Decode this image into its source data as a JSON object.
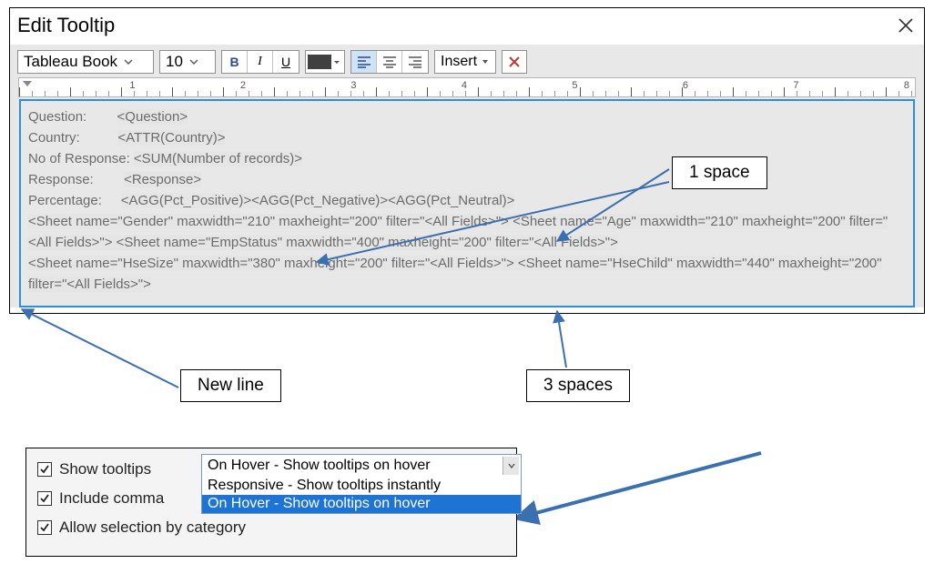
{
  "dialog": {
    "title": "Edit Tooltip",
    "font": "Tableau Book",
    "fontSize": "10",
    "insertLabel": "Insert",
    "ruler": [
      "1",
      "2",
      "3",
      "4",
      "5",
      "6",
      "7",
      "8"
    ]
  },
  "tooltip": {
    "r1a": "Question:        ",
    "r1b": "<Question>",
    "r2a": "Country:          ",
    "r2b": "<ATTR(Country)>",
    "r3a": "No of Response: ",
    "r3b": "<SUM(Number of records)>",
    "r4a": "Response:        ",
    "r4b": "<Response>",
    "r5a": "Percentage:     ",
    "r5b": "<AGG(Pct_Positive)><AGG(Pct_Negative)><AGG(Pct_Neutral)>",
    "l6": "<Sheet name=\"Gender\" maxwidth=\"210\" maxheight=\"200\" filter=\"<All Fields>\"> <Sheet name=\"Age\" maxwidth=\"210\" maxheight=\"200\" filter=\"<All Fields>\">   <Sheet name=\"EmpStatus\" maxwidth=\"400\" maxheight=\"200\" filter=\"<All Fields>\">",
    "l7": "<Sheet name=\"HseSize\" maxwidth=\"380\" maxheight=\"200\" filter=\"<All Fields>\">   <Sheet name=\"HseChild\" maxwidth=\"440\" maxheight=\"200\" filter=\"<All Fields>\">"
  },
  "annot": {
    "oneSpace": "1 space",
    "newLine": "New line",
    "threeSpaces": "3 spaces"
  },
  "options": {
    "showTooltips": "Show tooltips",
    "includeCommand": "Include comma",
    "allowSelection": "Allow selection by category",
    "dropdownSelected": "On Hover - Show tooltips on hover",
    "opt1": "Responsive - Show tooltips instantly",
    "opt2": "On Hover - Show tooltips on hover"
  }
}
